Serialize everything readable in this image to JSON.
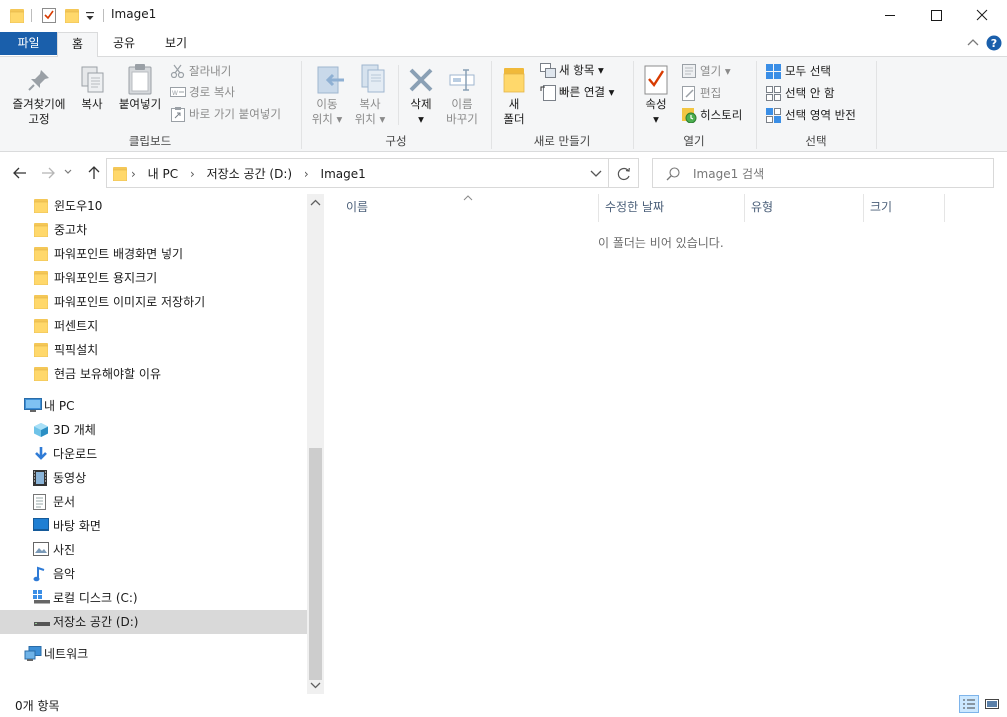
{
  "window": {
    "title": "Image1",
    "minimize_glyph": "—",
    "maximize_glyph": "☐",
    "close_glyph": "✕"
  },
  "ribbon_tabs": {
    "file": "파일",
    "home": "홈",
    "share": "공유",
    "view": "보기"
  },
  "ribbon": {
    "clipboard": {
      "label": "클립보드",
      "pin": "즐겨찾기에\n고정",
      "pin_l1": "즐겨찾기에",
      "pin_l2": "고정",
      "copy": "복사",
      "paste": "붙여넣기",
      "cut": "잘라내기",
      "copy_path": "경로 복사",
      "paste_shortcut": "바로 가기 붙여넣기"
    },
    "organize": {
      "label": "구성",
      "move_l1": "이동",
      "move_l2": "위치",
      "copy_l1": "복사",
      "copy_l2": "위치",
      "delete": "삭제",
      "rename_l1": "이름",
      "rename_l2": "바꾸기"
    },
    "new": {
      "label": "새로 만들기",
      "new_folder_l1": "새",
      "new_folder_l2": "폴더",
      "new_item": "새 항목",
      "easy_access": "빠른 연결"
    },
    "open": {
      "label": "열기",
      "properties": "속성",
      "open": "열기",
      "edit": "편집",
      "history": "히스토리"
    },
    "select": {
      "label": "선택",
      "select_all": "모두 선택",
      "select_none": "선택 안 함",
      "invert": "선택 영역 반전"
    }
  },
  "address": {
    "crumbs": [
      "내 PC",
      "저장소 공간 (D:)",
      "Image1"
    ],
    "search_placeholder": "Image1 검색"
  },
  "nav": {
    "folders": [
      "윈도우10",
      "중고차",
      "파워포인트 배경화면 넣기",
      "파워포인트 용지크기",
      "파워포인트 이미지로 저장하기",
      "퍼센트지",
      "픽픽설치",
      "현금 보유해야할 이유"
    ],
    "this_pc": "내 PC",
    "pc_items": [
      "3D 개체",
      "다운로드",
      "동영상",
      "문서",
      "바탕 화면",
      "사진",
      "음악",
      "로컬 디스크 (C:)",
      "저장소 공간 (D:)"
    ],
    "network": "네트워크",
    "selected_index": 8
  },
  "columns": {
    "name": "이름",
    "modified": "수정한 날짜",
    "type": "유형",
    "size": "크기"
  },
  "empty_message": "이 폴더는 비어 있습니다.",
  "status": {
    "items": "0개 항목"
  },
  "colors": {
    "file_tab": "#1a5fab",
    "selection": "#d9d9d9",
    "ribbon_bg": "#f5f6f7",
    "folder": "#ffd86b"
  }
}
